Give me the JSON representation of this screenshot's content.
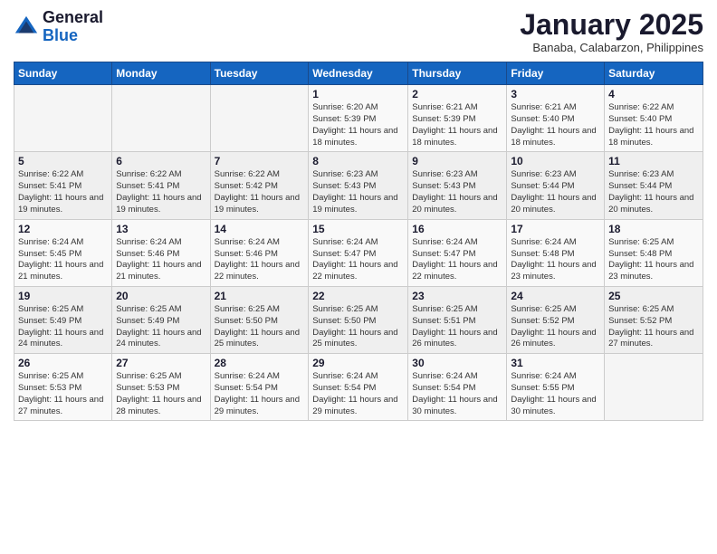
{
  "header": {
    "logo_general": "General",
    "logo_blue": "Blue",
    "month_title": "January 2025",
    "subtitle": "Banaba, Calabarzon, Philippines"
  },
  "days_of_week": [
    "Sunday",
    "Monday",
    "Tuesday",
    "Wednesday",
    "Thursday",
    "Friday",
    "Saturday"
  ],
  "weeks": [
    [
      {
        "day": "",
        "info": ""
      },
      {
        "day": "",
        "info": ""
      },
      {
        "day": "",
        "info": ""
      },
      {
        "day": "1",
        "info": "Sunrise: 6:20 AM\nSunset: 5:39 PM\nDaylight: 11 hours and 18 minutes."
      },
      {
        "day": "2",
        "info": "Sunrise: 6:21 AM\nSunset: 5:39 PM\nDaylight: 11 hours and 18 minutes."
      },
      {
        "day": "3",
        "info": "Sunrise: 6:21 AM\nSunset: 5:40 PM\nDaylight: 11 hours and 18 minutes."
      },
      {
        "day": "4",
        "info": "Sunrise: 6:22 AM\nSunset: 5:40 PM\nDaylight: 11 hours and 18 minutes."
      }
    ],
    [
      {
        "day": "5",
        "info": "Sunrise: 6:22 AM\nSunset: 5:41 PM\nDaylight: 11 hours and 19 minutes."
      },
      {
        "day": "6",
        "info": "Sunrise: 6:22 AM\nSunset: 5:41 PM\nDaylight: 11 hours and 19 minutes."
      },
      {
        "day": "7",
        "info": "Sunrise: 6:22 AM\nSunset: 5:42 PM\nDaylight: 11 hours and 19 minutes."
      },
      {
        "day": "8",
        "info": "Sunrise: 6:23 AM\nSunset: 5:43 PM\nDaylight: 11 hours and 19 minutes."
      },
      {
        "day": "9",
        "info": "Sunrise: 6:23 AM\nSunset: 5:43 PM\nDaylight: 11 hours and 20 minutes."
      },
      {
        "day": "10",
        "info": "Sunrise: 6:23 AM\nSunset: 5:44 PM\nDaylight: 11 hours and 20 minutes."
      },
      {
        "day": "11",
        "info": "Sunrise: 6:23 AM\nSunset: 5:44 PM\nDaylight: 11 hours and 20 minutes."
      }
    ],
    [
      {
        "day": "12",
        "info": "Sunrise: 6:24 AM\nSunset: 5:45 PM\nDaylight: 11 hours and 21 minutes."
      },
      {
        "day": "13",
        "info": "Sunrise: 6:24 AM\nSunset: 5:46 PM\nDaylight: 11 hours and 21 minutes."
      },
      {
        "day": "14",
        "info": "Sunrise: 6:24 AM\nSunset: 5:46 PM\nDaylight: 11 hours and 22 minutes."
      },
      {
        "day": "15",
        "info": "Sunrise: 6:24 AM\nSunset: 5:47 PM\nDaylight: 11 hours and 22 minutes."
      },
      {
        "day": "16",
        "info": "Sunrise: 6:24 AM\nSunset: 5:47 PM\nDaylight: 11 hours and 22 minutes."
      },
      {
        "day": "17",
        "info": "Sunrise: 6:24 AM\nSunset: 5:48 PM\nDaylight: 11 hours and 23 minutes."
      },
      {
        "day": "18",
        "info": "Sunrise: 6:25 AM\nSunset: 5:48 PM\nDaylight: 11 hours and 23 minutes."
      }
    ],
    [
      {
        "day": "19",
        "info": "Sunrise: 6:25 AM\nSunset: 5:49 PM\nDaylight: 11 hours and 24 minutes."
      },
      {
        "day": "20",
        "info": "Sunrise: 6:25 AM\nSunset: 5:49 PM\nDaylight: 11 hours and 24 minutes."
      },
      {
        "day": "21",
        "info": "Sunrise: 6:25 AM\nSunset: 5:50 PM\nDaylight: 11 hours and 25 minutes."
      },
      {
        "day": "22",
        "info": "Sunrise: 6:25 AM\nSunset: 5:50 PM\nDaylight: 11 hours and 25 minutes."
      },
      {
        "day": "23",
        "info": "Sunrise: 6:25 AM\nSunset: 5:51 PM\nDaylight: 11 hours and 26 minutes."
      },
      {
        "day": "24",
        "info": "Sunrise: 6:25 AM\nSunset: 5:52 PM\nDaylight: 11 hours and 26 minutes."
      },
      {
        "day": "25",
        "info": "Sunrise: 6:25 AM\nSunset: 5:52 PM\nDaylight: 11 hours and 27 minutes."
      }
    ],
    [
      {
        "day": "26",
        "info": "Sunrise: 6:25 AM\nSunset: 5:53 PM\nDaylight: 11 hours and 27 minutes."
      },
      {
        "day": "27",
        "info": "Sunrise: 6:25 AM\nSunset: 5:53 PM\nDaylight: 11 hours and 28 minutes."
      },
      {
        "day": "28",
        "info": "Sunrise: 6:24 AM\nSunset: 5:54 PM\nDaylight: 11 hours and 29 minutes."
      },
      {
        "day": "29",
        "info": "Sunrise: 6:24 AM\nSunset: 5:54 PM\nDaylight: 11 hours and 29 minutes."
      },
      {
        "day": "30",
        "info": "Sunrise: 6:24 AM\nSunset: 5:54 PM\nDaylight: 11 hours and 30 minutes."
      },
      {
        "day": "31",
        "info": "Sunrise: 6:24 AM\nSunset: 5:55 PM\nDaylight: 11 hours and 30 minutes."
      },
      {
        "day": "",
        "info": ""
      }
    ]
  ]
}
